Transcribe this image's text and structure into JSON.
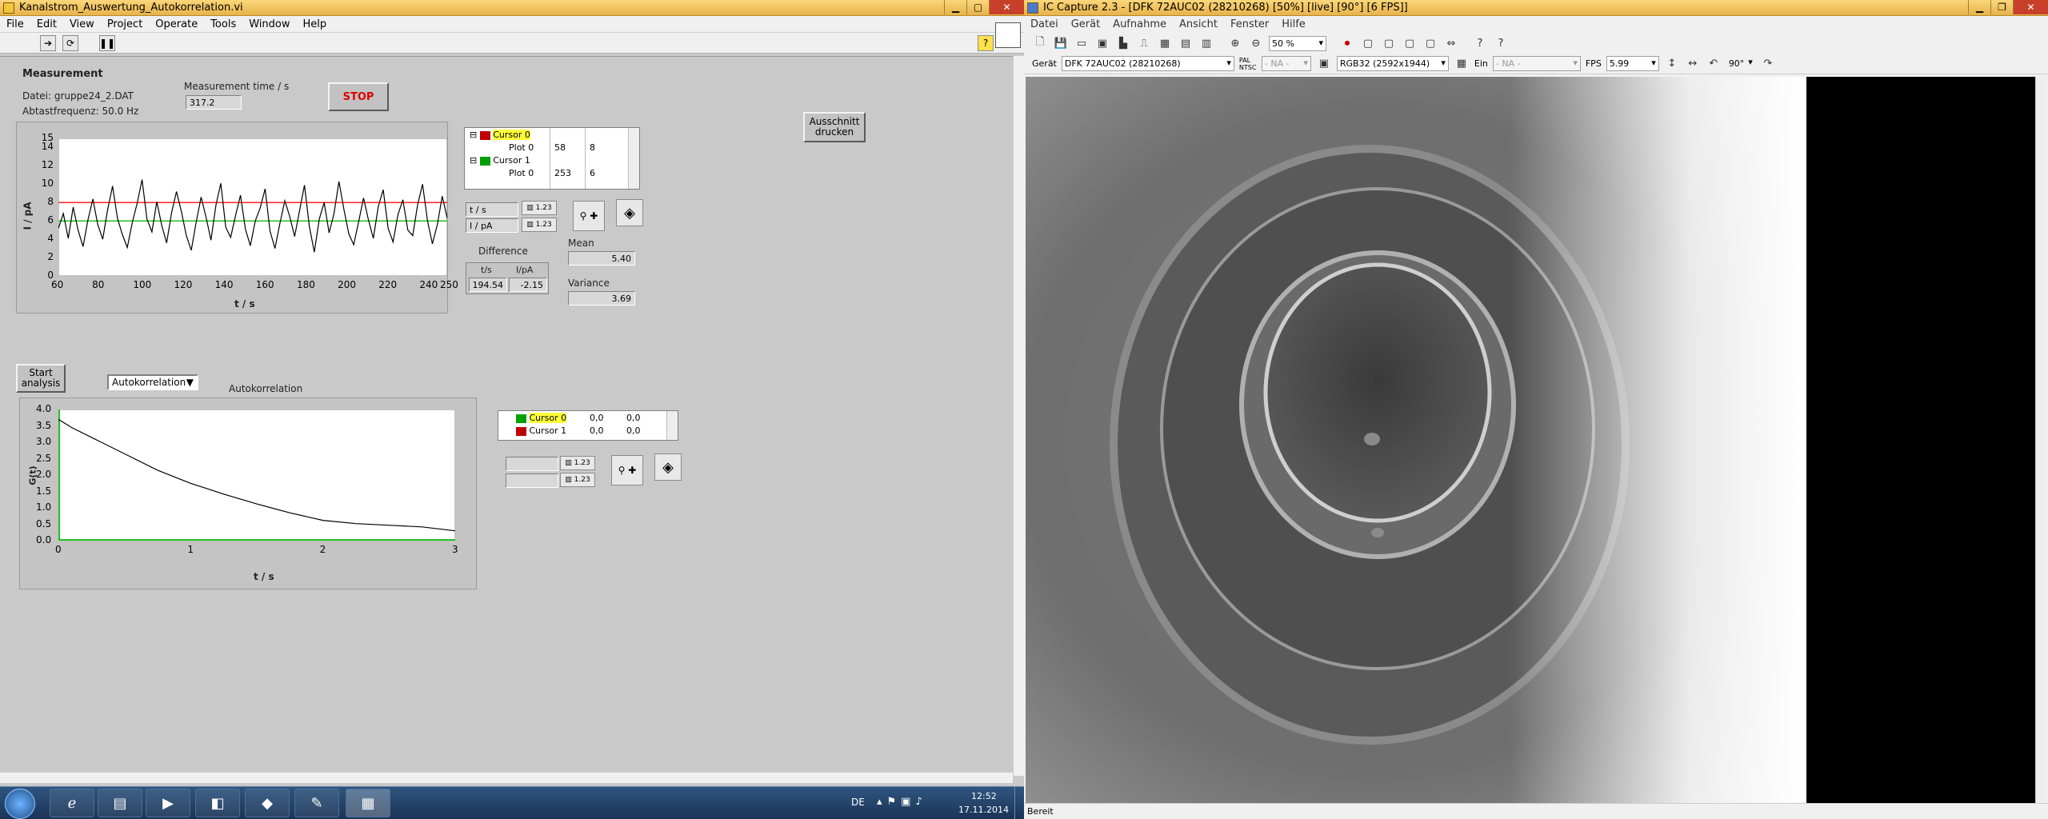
{
  "labview": {
    "title": "Kanalstrom_Auswertung_Autokorrelation.vi",
    "menu": [
      "File",
      "Edit",
      "View",
      "Project",
      "Operate",
      "Tools",
      "Window",
      "Help"
    ],
    "help_icon": "?",
    "section_title": "Measurement",
    "file_label": "Datei: gruppe24_2.DAT",
    "freq_label": "Abtastfrequenz: 50.0 Hz",
    "meas_time_label": "Measurement time / s",
    "meas_time_value": "317.2",
    "stop_label": "STOP",
    "print_label_1": "Ausschnitt",
    "print_label_2": "drucken",
    "graph1": {
      "ylabel": "I / pA",
      "xlabel": "t / s",
      "yticks": [
        "15",
        "14",
        "12",
        "10",
        "8",
        "6",
        "4",
        "2",
        "0"
      ],
      "xticks": [
        "60",
        "80",
        "100",
        "120",
        "140",
        "160",
        "180",
        "200",
        "220",
        "240",
        "250"
      ],
      "red_cursor_y": 8,
      "green_cursor_y": 6
    },
    "cursors1": [
      {
        "name": "Cursor 0",
        "x": "",
        "y": "",
        "highlight": true,
        "color": "#c00000"
      },
      {
        "name": "Plot 0",
        "x": "58",
        "y": "8"
      },
      {
        "name": "Cursor 1",
        "x": "",
        "y": "",
        "color": "#00a000"
      },
      {
        "name": "Plot 0",
        "x": "253",
        "y": "6"
      }
    ],
    "scale_x": "t / s",
    "scale_y": "I / pA",
    "difference_label": "Difference",
    "diff_col_t": "t/s",
    "diff_col_i": "I/pA",
    "diff_t": "194.54",
    "diff_i": "-2.15",
    "mean_label": "Mean",
    "mean_value": "5.40",
    "variance_label": "Variance",
    "variance_value": "3.69",
    "start_label_1": "Start",
    "start_label_2": "analysis",
    "analysis_select": "Autokorrelation",
    "graph2_title": "Autokorrelation",
    "graph2": {
      "ylabel": "G(t)",
      "xlabel": "t / s",
      "yticks": [
        "4.0",
        "3.5",
        "3.0",
        "2.5",
        "2.0",
        "1.5",
        "1.0",
        "0.5",
        "0.0"
      ],
      "xticks": [
        "0",
        "1",
        "2",
        "3"
      ]
    },
    "cursors2": [
      {
        "name": "Cursor 0",
        "x": "0,0",
        "y": "0,0",
        "highlight": true,
        "color": "#00a000"
      },
      {
        "name": "Cursor 1",
        "x": "0,0",
        "y": "0,0",
        "color": "#c00000"
      }
    ]
  },
  "chart_data": [
    {
      "type": "line",
      "title": "",
      "xlabel": "t / s",
      "ylabel": "I / pA",
      "xlim": [
        60,
        250
      ],
      "ylim": [
        0,
        15
      ],
      "grid": false,
      "series": [
        {
          "values": [
            5.2,
            6.8,
            4.1,
            7.5,
            5.0,
            3.2,
            6.1,
            8.4,
            5.6,
            4.0,
            7.2,
            9.8,
            6.3,
            4.5,
            3.1,
            5.8,
            7.9,
            10.5,
            6.2,
            4.8,
            8.1,
            5.5,
            3.6,
            6.9,
            9.2,
            7.0,
            4.4,
            2.8,
            5.9,
            8.6,
            6.4,
            3.9,
            7.7,
            10.1,
            5.3,
            4.2,
            6.6,
            8.8,
            5.1,
            3.3,
            6.0,
            7.4,
            9.5,
            4.9,
            3.0,
            5.7,
            8.2,
            6.5,
            4.3,
            7.1,
            9.9,
            5.4,
            2.6,
            6.2,
            8.0,
            4.7,
            6.8,
            10.3,
            7.3,
            4.6,
            3.4,
            5.9,
            8.5,
            6.1,
            4.1,
            7.6,
            9.4,
            5.2,
            3.7,
            6.7,
            8.3,
            5.0,
            4.4,
            7.8,
            10.0,
            6.0,
            3.5,
            5.6,
            8.7,
            6.3
          ]
        },
        {
          "name": "Cursor 0",
          "values": [
            8,
            8
          ]
        },
        {
          "name": "Cursor 1",
          "values": [
            6,
            6
          ]
        }
      ]
    },
    {
      "type": "line",
      "title": "Autokorrelation",
      "xlabel": "t / s",
      "ylabel": "G(t)",
      "xlim": [
        0,
        3
      ],
      "ylim": [
        0,
        4.0
      ],
      "grid": false,
      "series": [
        {
          "x": [
            0,
            0.1,
            0.25,
            0.5,
            0.75,
            1.0,
            1.25,
            1.5,
            1.75,
            2.0,
            2.25,
            2.5,
            2.75,
            3.0
          ],
          "values": [
            3.7,
            3.45,
            3.15,
            2.65,
            2.15,
            1.75,
            1.42,
            1.12,
            0.85,
            0.62,
            0.52,
            0.47,
            0.42,
            0.3
          ]
        }
      ]
    }
  ],
  "taskbar": {
    "lang": "DE",
    "time": "12:52",
    "date": "17.11.2014"
  },
  "iccapture": {
    "title": "IC Capture 2.3 - [DFK 72AUC02 (28210268) [50%]  [live]  [90°]  [6 FPS]]",
    "menu": [
      "Datei",
      "Gerät",
      "Aufnahme",
      "Ansicht",
      "Fenster",
      "Hilfe"
    ],
    "zoom": "50 %",
    "device_label": "Gerät",
    "device_value": "DFK 72AUC02 (28210268)",
    "pal_label": "PAL NTSC",
    "na1": "- NA -",
    "format_value": "RGB32 (2592x1944)",
    "ein_label": "Ein",
    "na2": "- NA -",
    "fps_label": "FPS",
    "fps_value": "5.99",
    "rotate_value": "90°",
    "status": "Bereit"
  }
}
